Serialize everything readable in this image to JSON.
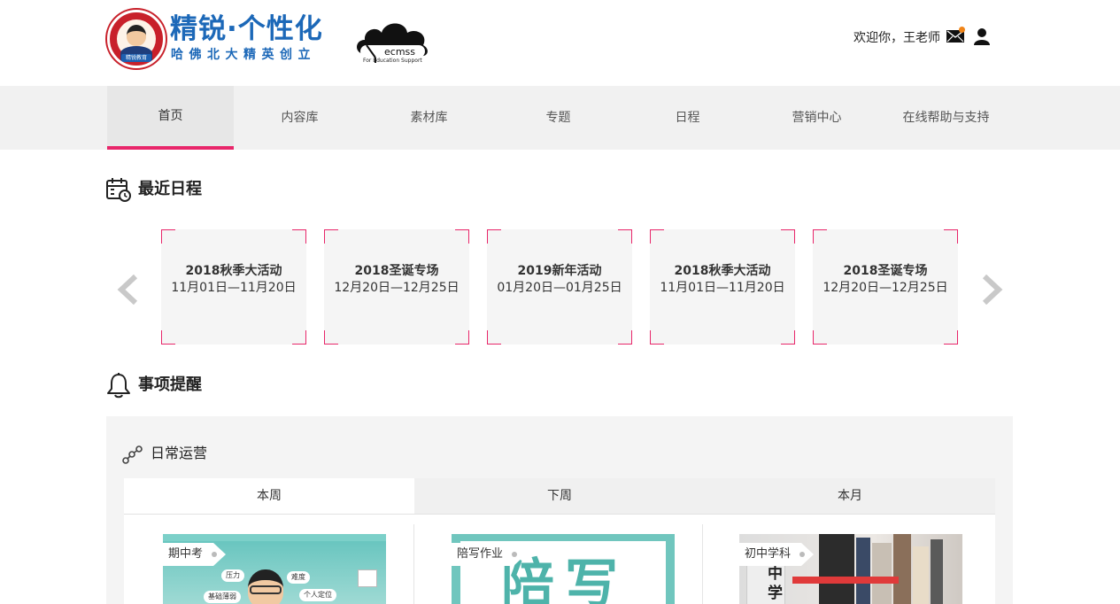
{
  "header": {
    "brand_title": "精锐·个性化",
    "brand_subtitle": "哈佛北大精英创立",
    "badge_text": "精锐教育",
    "partner_logo": "ecmss",
    "partner_tagline": "For Education Support",
    "welcome_text": "欢迎你，王老师",
    "mail_icon": "mail-icon",
    "user_icon": "user-icon",
    "notification_color": "#f08418"
  },
  "nav": {
    "accent_color": "#e8266a",
    "active_index": 0,
    "items": [
      "首页",
      "内容库",
      "素材库",
      "专题",
      "日程",
      "营销中心",
      "在线帮助与支持"
    ]
  },
  "schedule": {
    "title": "最近日程",
    "icon": "calendar-clock-icon",
    "cards": [
      {
        "name": "2018秋季大活动",
        "date": "11月01日—11月20日"
      },
      {
        "name": "2018圣诞专场",
        "date": "12月20日—12月25日"
      },
      {
        "name": "2019新年活动",
        "date": "01月20日—01月25日"
      },
      {
        "name": "2018秋季大活动",
        "date": "11月01日—11月20日"
      },
      {
        "name": "2018圣诞专场",
        "date": "12月20日—12月25日"
      }
    ]
  },
  "reminders": {
    "title": "事项提醒",
    "icon": "bell-icon",
    "daily": {
      "title": "日常运营",
      "icon": "connected-dots-icon",
      "tabs": [
        "本周",
        "下周",
        "本月"
      ],
      "active_tab": 0,
      "items": [
        {
          "label": "期中考",
          "bubbles": [
            "压力",
            "难度",
            "基础薄弱",
            "个人定位"
          ]
        },
        {
          "label": "陪写作业",
          "art_text": "陪写"
        },
        {
          "label": "初中学科",
          "art_text": "中学"
        }
      ]
    }
  }
}
